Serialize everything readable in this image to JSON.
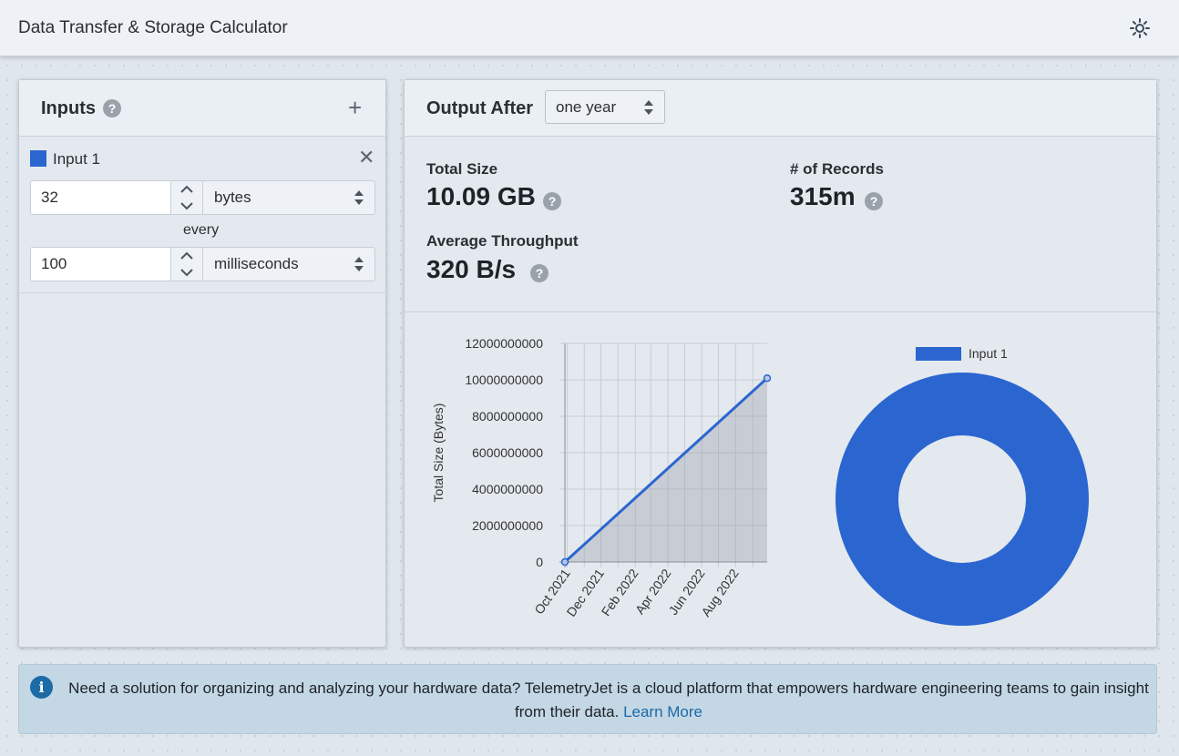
{
  "app": {
    "title": "Data Transfer & Storage Calculator",
    "settings_icon": "gear-icon"
  },
  "inputs_panel": {
    "title": "Inputs",
    "help_icon": "?",
    "add_icon": "+",
    "items": [
      {
        "name": "Input 1",
        "color": "#2b66d0",
        "close_icon": "✕",
        "size_value": "32",
        "size_unit": "bytes",
        "every_label": "every",
        "interval_value": "100",
        "interval_unit": "milliseconds"
      }
    ]
  },
  "output_panel": {
    "title": "Output After",
    "period": "one year",
    "stats": {
      "total_size": {
        "label": "Total Size",
        "value": "10.09 GB"
      },
      "records": {
        "label": "# of Records",
        "value": "315m"
      },
      "throughput": {
        "label": "Average Throughput",
        "value": "320 B/s"
      }
    },
    "help_icon": "?"
  },
  "chart_data": [
    {
      "type": "area",
      "ylabel": "Total Size (Bytes)",
      "ylim": [
        0,
        12000000000
      ],
      "yticks": [
        0,
        2000000000,
        4000000000,
        6000000000,
        8000000000,
        10000000000,
        12000000000
      ],
      "ytick_labels": [
        "0",
        "2000000000",
        "4000000000",
        "6000000000",
        "8000000000",
        "10000000000",
        "12000000000"
      ],
      "xtick_labels": [
        "Oct 2021",
        "Dec 2021",
        "Feb 2022",
        "Apr 2022",
        "Jun 2022",
        "Aug 2022"
      ],
      "x": [
        "2021-09-27",
        "2022-09-27"
      ],
      "series": [
        {
          "values": [
            0,
            10090000000
          ],
          "color": "#2b66d0"
        }
      ],
      "grid": true
    },
    {
      "type": "pie",
      "style": "doughnut",
      "legend": "top",
      "labels": [
        "Input 1"
      ],
      "values": [
        100
      ],
      "colors": [
        "#2b66d0"
      ]
    }
  ],
  "banner": {
    "info_icon": "i",
    "text": "Need a solution for organizing and analyzing your hardware data? TelemetryJet is a cloud platform that empowers hardware engineering teams to gain insight from their data.",
    "link_label": "Learn More"
  }
}
